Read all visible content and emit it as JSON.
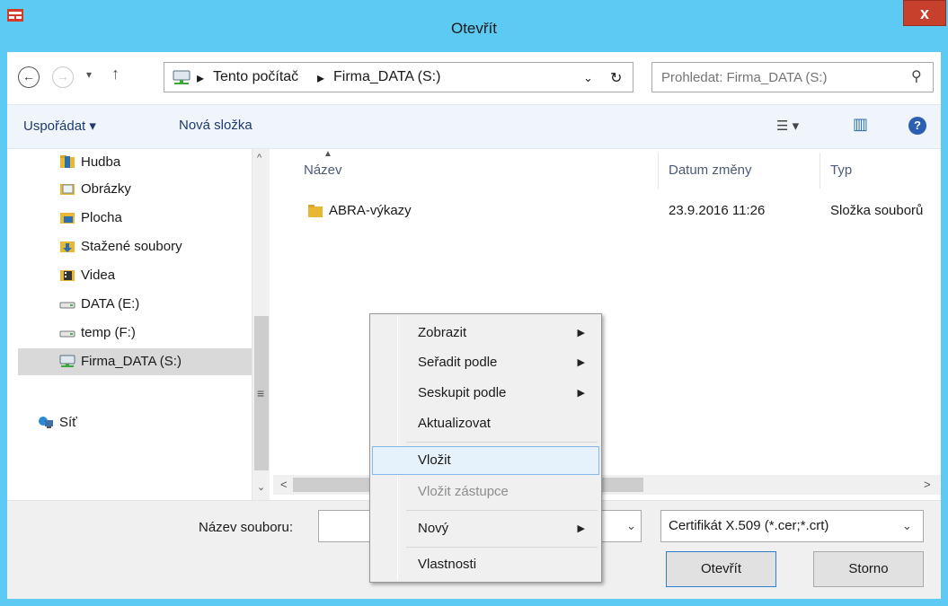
{
  "window": {
    "title": "Otevřít",
    "close_glyph": "x"
  },
  "address": {
    "back_glyph": "←",
    "forward_glyph": "→",
    "recent_glyph": "▾",
    "up_glyph": "↑",
    "crumb_sep": "▸",
    "crumbs": [
      "Tento počítač",
      "Firma_DATA (S:)"
    ],
    "dropdown_glyph": "⌄",
    "refresh_glyph": "↻",
    "search_placeholder": "Prohledat: Firma_DATA (S:)",
    "search_glyph": "⚲"
  },
  "toolbar": {
    "organize_label": "Uspořádat ▾",
    "new_folder_label": "Nová složka",
    "view_glyph": "☰ ▾",
    "pane_glyph": "▥",
    "help_glyph": "?"
  },
  "nav": {
    "items": [
      {
        "label": "Hudba"
      },
      {
        "label": "Obrázky"
      },
      {
        "label": "Plocha"
      },
      {
        "label": "Stažené soubory"
      },
      {
        "label": "Videa"
      },
      {
        "label": "DATA (E:)"
      },
      {
        "label": "temp (F:)"
      },
      {
        "label": "Firma_DATA (S:)"
      },
      {
        "label": "Síť"
      }
    ],
    "scroll_up": "^",
    "scroll_down": "⌄",
    "scroll_grip": "≡"
  },
  "filelist": {
    "columns": [
      "Název",
      "Datum změny",
      "Typ"
    ],
    "sort_glyph": "▲",
    "rows": [
      {
        "name": "ABRA-výkazy",
        "date": "23.9.2016 11:26",
        "type": "Složka souborů"
      }
    ],
    "scroll_left": "<",
    "scroll_right": ">"
  },
  "bottom": {
    "filename_label": "Název souboru:",
    "filename_value": "",
    "filetype_value": "Certifikát X.509 (*.cer;*.crt)",
    "dropdown_glyph": "⌄",
    "open_label": "Otevřít",
    "cancel_label": "Storno"
  },
  "context_menu": {
    "submenu_glyph": "▶",
    "items": [
      {
        "label": "Zobrazit"
      },
      {
        "label": "Seřadit podle"
      },
      {
        "label": "Seskupit podle"
      },
      {
        "label": "Aktualizovat"
      },
      {
        "label": "Vložit"
      },
      {
        "label": "Vložit zástupce"
      },
      {
        "label": "Nový"
      },
      {
        "label": "Vlastnosti"
      }
    ]
  },
  "colors": {
    "title_bar": "#5ccaf2",
    "close_button": "#c7402c",
    "toolbar_bg": "#f0f5fb",
    "link_text": "#1e3a6e",
    "highlight_bg": "#e5f1fb",
    "highlight_border": "#84b8e8",
    "folder_yellow": "#e8b834"
  }
}
